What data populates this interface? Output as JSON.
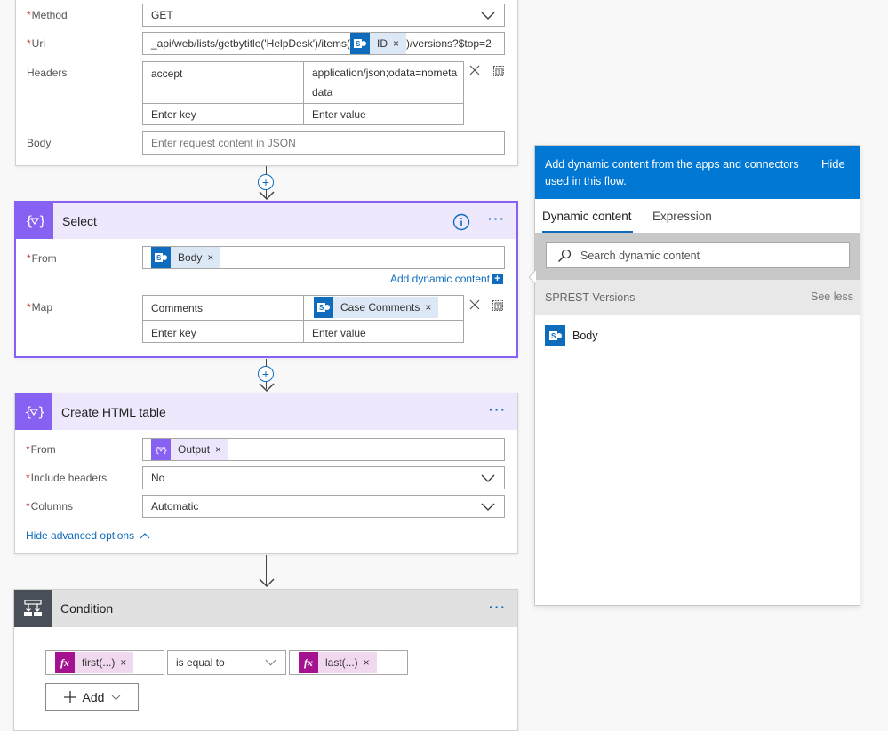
{
  "http_action": {
    "method": {
      "label": "Method",
      "required": true,
      "value": "GET"
    },
    "uri": {
      "label": "Uri",
      "required": true,
      "prefix": "_api/web/lists/getbytitle('HelpDesk')/items(",
      "token": "ID",
      "suffix": ")/versions?$top=2"
    },
    "headers": {
      "label": "Headers",
      "rows": [
        {
          "key": "accept",
          "value_line1": "application/json;odata=nometa",
          "value_line2": "data"
        }
      ],
      "key_placeholder": "Enter key",
      "value_placeholder": "Enter value"
    },
    "body": {
      "label": "Body",
      "placeholder": "Enter request content in JSON"
    }
  },
  "select_action": {
    "title": "Select",
    "from": {
      "label": "From",
      "required": true,
      "token": "Body"
    },
    "add_dynamic_content": "Add dynamic content",
    "map": {
      "label": "Map",
      "required": true,
      "key": "Comments",
      "value_token": "Case Comments",
      "key_placeholder": "Enter key",
      "value_placeholder": "Enter value"
    }
  },
  "html_table_action": {
    "title": "Create HTML table",
    "from": {
      "label": "From",
      "required": true,
      "token": "Output"
    },
    "include_headers": {
      "label": "Include headers",
      "required": true,
      "value": "No"
    },
    "columns": {
      "label": "Columns",
      "required": true,
      "value": "Automatic"
    },
    "hide_advanced": "Hide advanced options"
  },
  "condition": {
    "title": "Condition",
    "left_token": "first(...)",
    "operator": "is equal to",
    "right_token": "last(...)",
    "add_label": "Add"
  },
  "dynamic_panel": {
    "banner_text": "Add dynamic content from the apps and connectors used in this flow.",
    "hide_label": "Hide",
    "tabs": [
      {
        "label": "Dynamic content",
        "active": true
      },
      {
        "label": "Expression",
        "active": false
      }
    ],
    "search_placeholder": "Search dynamic content",
    "section_title": "SPREST-Versions",
    "see_less": "See less",
    "items": [
      {
        "label": "Body"
      }
    ]
  },
  "colors": {
    "accent": "#0f6cbd",
    "panel_banner": "#0078d4",
    "data_ops": "#8661f2",
    "expression": "#a4128f",
    "condition": "#484f58"
  }
}
